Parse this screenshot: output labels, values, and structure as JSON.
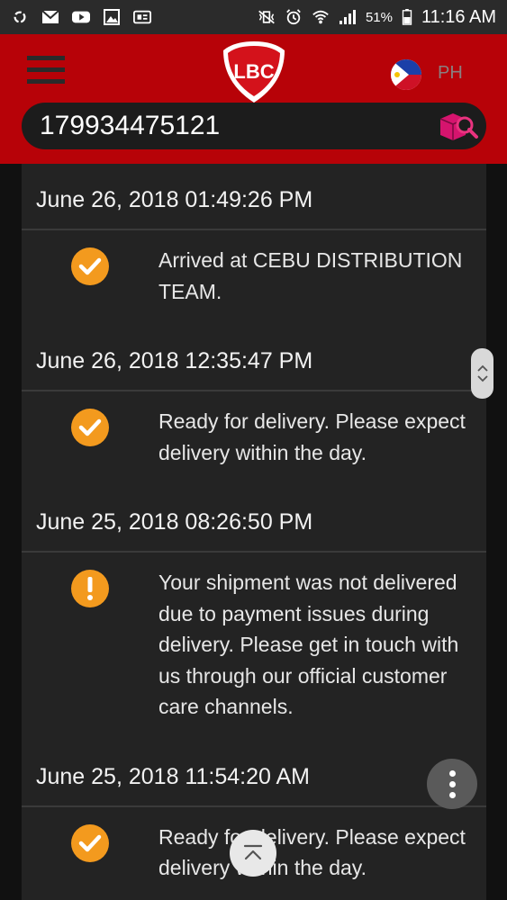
{
  "status_bar": {
    "battery_pct": "51%",
    "time": "11:16 AM"
  },
  "header": {
    "logo_text": "LBC",
    "country": "PH"
  },
  "search": {
    "value": "179934475121",
    "placeholder": ""
  },
  "entries": [
    {
      "date": "June 26, 2018 01:49:26 PM",
      "status": "check",
      "message": "Arrived at CEBU DISTRIBUTION TEAM."
    },
    {
      "date": "June 26, 2018 12:35:47 PM",
      "status": "check",
      "message": "Ready for delivery. Please expect delivery within the day."
    },
    {
      "date": "June 25, 2018 08:26:50 PM",
      "status": "alert",
      "message": "Your shipment was not delivered due to payment issues during delivery. Please get in touch with us through our official customer care channels."
    },
    {
      "date": "June 25, 2018 11:54:20 AM",
      "status": "check",
      "message": "Ready for delivery. Please expect delivery within the day."
    }
  ],
  "colors": {
    "brand_red": "#b70208",
    "status_orange": "#f39a1e",
    "panel": "#232323"
  },
  "icons": {
    "menu": "hamburger-icon",
    "search": "package-search-icon",
    "status_check": "check-circle-icon",
    "status_alert": "exclamation-circle-icon"
  }
}
